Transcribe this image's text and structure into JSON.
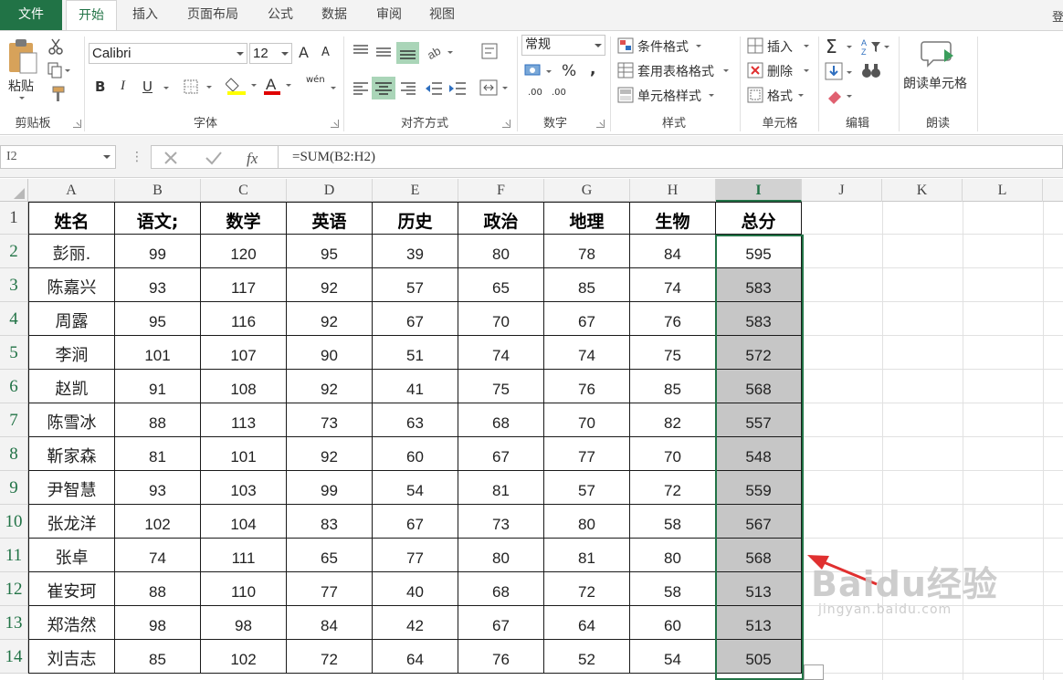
{
  "tabs": [
    "文件",
    "开始",
    "插入",
    "页面布局",
    "公式",
    "数据",
    "审阅",
    "视图"
  ],
  "tab_cut": "登",
  "ribbon": {
    "clipboard": {
      "paste": "粘贴",
      "label": "剪贴板"
    },
    "font": {
      "name": "Calibri",
      "size": "12",
      "bold": "B",
      "italic": "I",
      "underline": "U",
      "label": "字体",
      "grow": "A",
      "shrink": "A",
      "phonetic": "wén"
    },
    "alignment": {
      "label": "对齐方式"
    },
    "number": {
      "format": "常规",
      "percent": "%",
      "comma": ",",
      "inc_dec": ".00",
      "dec_dec": ".00",
      "label": "数字"
    },
    "styles": {
      "conditional": "条件格式",
      "table": "套用表格格式",
      "cell_styles": "单元格样式",
      "label": "样式"
    },
    "cells": {
      "insert": "插入",
      "delete": "删除",
      "format": "格式",
      "label": "单元格"
    },
    "editing": {
      "label": "编辑"
    },
    "speech": {
      "read_cells": "朗读单元格",
      "label": "朗读"
    }
  },
  "formula_bar": {
    "name_box": "I2",
    "formula": "=SUM(B2:H2)"
  },
  "columns": [
    "A",
    "B",
    "C",
    "D",
    "E",
    "F",
    "G",
    "H",
    "I",
    "J",
    "K",
    "L"
  ],
  "selected_column": "I",
  "table": {
    "headers": [
      "姓名",
      "语文;",
      "数学",
      "英语",
      "历史",
      "政治",
      "地理",
      "生物",
      "总分"
    ],
    "rows": [
      [
        "彭丽.",
        "99",
        "120",
        "95",
        "39",
        "80",
        "78",
        "84",
        "595"
      ],
      [
        "陈嘉兴",
        "93",
        "117",
        "92",
        "57",
        "65",
        "85",
        "74",
        "583"
      ],
      [
        "周露",
        "95",
        "116",
        "92",
        "67",
        "70",
        "67",
        "76",
        "583"
      ],
      [
        "李涧",
        "101",
        "107",
        "90",
        "51",
        "74",
        "74",
        "75",
        "572"
      ],
      [
        "赵凯",
        "91",
        "108",
        "92",
        "41",
        "75",
        "76",
        "85",
        "568"
      ],
      [
        "陈雪冰",
        "88",
        "113",
        "73",
        "63",
        "68",
        "70",
        "82",
        "557"
      ],
      [
        "靳家森",
        "81",
        "101",
        "92",
        "60",
        "67",
        "77",
        "70",
        "548"
      ],
      [
        "尹智慧",
        "93",
        "103",
        "99",
        "54",
        "81",
        "57",
        "72",
        "559"
      ],
      [
        "张龙洋",
        "102",
        "104",
        "83",
        "67",
        "73",
        "80",
        "58",
        "567"
      ],
      [
        "张卓",
        "74",
        "111",
        "65",
        "77",
        "80",
        "81",
        "80",
        "568"
      ],
      [
        "崔安珂",
        "88",
        "110",
        "77",
        "40",
        "68",
        "72",
        "58",
        "513"
      ],
      [
        "郑浩然",
        "98",
        "98",
        "84",
        "42",
        "67",
        "64",
        "60",
        "513"
      ],
      [
        "刘吉志",
        "85",
        "102",
        "72",
        "64",
        "76",
        "52",
        "54",
        "505"
      ]
    ]
  },
  "row_numbers": [
    "1",
    "2",
    "3",
    "4",
    "5",
    "6",
    "7",
    "8",
    "9",
    "10",
    "11",
    "12",
    "13",
    "14"
  ],
  "watermark": {
    "brand": "Baidu经验",
    "url": "jingyan.baidu.com"
  },
  "colors": {
    "excel_green": "#217346",
    "selection_fill": "#c6c6c6",
    "arrow_red": "#e03030"
  }
}
